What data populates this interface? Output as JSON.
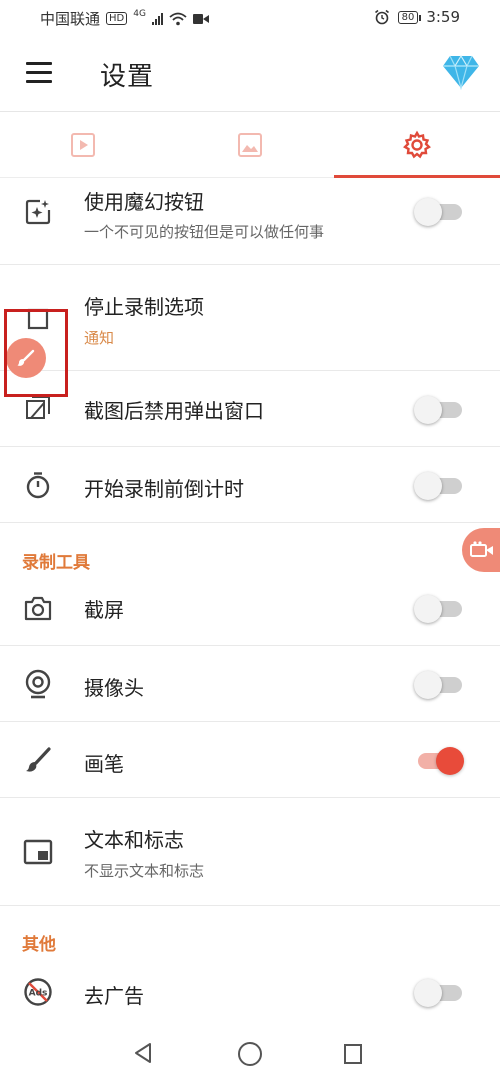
{
  "status_bar": {
    "carrier": "中国联通",
    "hd_badge": "HD",
    "network": "4G",
    "battery": "80",
    "time": "3:59"
  },
  "appbar": {
    "title": "设置"
  },
  "tabs": [
    {
      "name": "video-tab",
      "active": false
    },
    {
      "name": "image-tab",
      "active": false
    },
    {
      "name": "settings-tab",
      "active": true
    }
  ],
  "settings": {
    "magic_button": {
      "label": "使用魔幻按钮",
      "desc": "一个不可见的按钮但是可以做任何事",
      "enabled": false
    },
    "stop_recording": {
      "label": "停止录制选项",
      "value": "通知"
    },
    "disable_popup": {
      "label": "截图后禁用弹出窗口",
      "enabled": false
    },
    "countdown": {
      "label": "开始录制前倒计时",
      "enabled": false
    }
  },
  "tools_section": {
    "title": "录制工具",
    "items": {
      "screenshot": {
        "label": "截屏",
        "enabled": false
      },
      "camera": {
        "label": "摄像头",
        "enabled": false
      },
      "brush": {
        "label": "画笔",
        "enabled": true
      },
      "text_logo": {
        "label": "文本和标志",
        "desc": "不显示文本和标志"
      }
    }
  },
  "other_section": {
    "title": "其他",
    "items": {
      "remove_ads": {
        "label": "去广告",
        "enabled": false
      }
    }
  },
  "colors": {
    "accent": "#e84b3a",
    "section": "#e07a3a",
    "float_button": "#ef8a77",
    "highlight_box": "#c8201e"
  },
  "icons": [
    "menu-icon",
    "diamond-icon",
    "video-icon",
    "image-icon",
    "gear-icon",
    "magic-sparkle-icon",
    "stop-icon",
    "screenshot-popup-icon",
    "timer-icon",
    "camera-icon",
    "webcam-icon",
    "brush-icon",
    "picture-in-picture-icon",
    "no-ads-icon",
    "video-camera-icon"
  ]
}
